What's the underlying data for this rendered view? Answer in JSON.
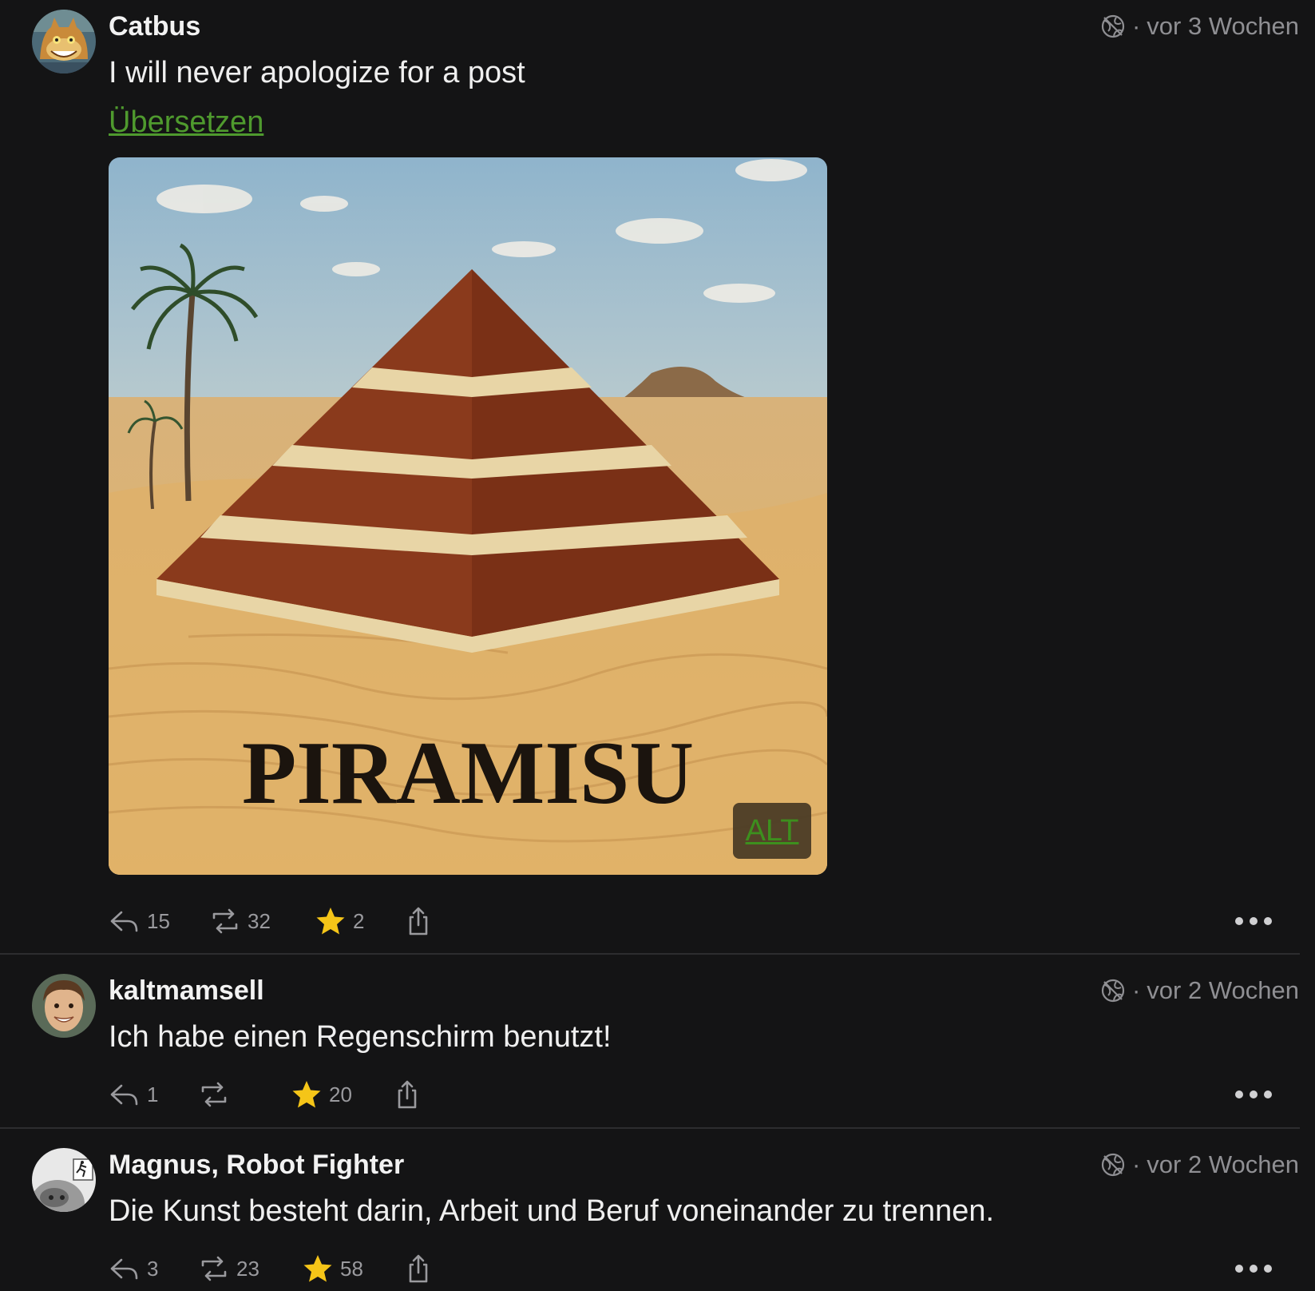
{
  "posts": [
    {
      "author": "Catbus",
      "visibility_icon": "globe-off-icon",
      "separator": "·",
      "time": "vor 3 Wochen",
      "text": "I will never apologize for a post",
      "translate_label": "Übersetzen",
      "image": {
        "caption_text": "PIRAMISU",
        "alt_label": "ALT"
      },
      "replies": "15",
      "boosts": "32",
      "favourites": "2"
    },
    {
      "author": "kaltmamsell",
      "visibility_icon": "globe-off-icon",
      "separator": "·",
      "time": "vor 2 Wochen",
      "text": "Ich habe einen Regenschirm benutzt!",
      "replies": "1",
      "boosts": "",
      "favourites": "20"
    },
    {
      "author": "Magnus, Robot Fighter",
      "visibility_icon": "globe-off-icon",
      "separator": "·",
      "time": "vor 2 Wochen",
      "text": "Die Kunst besteht darin, Arbeit und Beruf voneinander zu trennen.",
      "replies": "3",
      "boosts": "23",
      "favourites": "58"
    }
  ],
  "colors": {
    "background": "#141415",
    "link_green": "#4f9a2e",
    "star": "#f5c518",
    "muted": "#8f8f93"
  }
}
